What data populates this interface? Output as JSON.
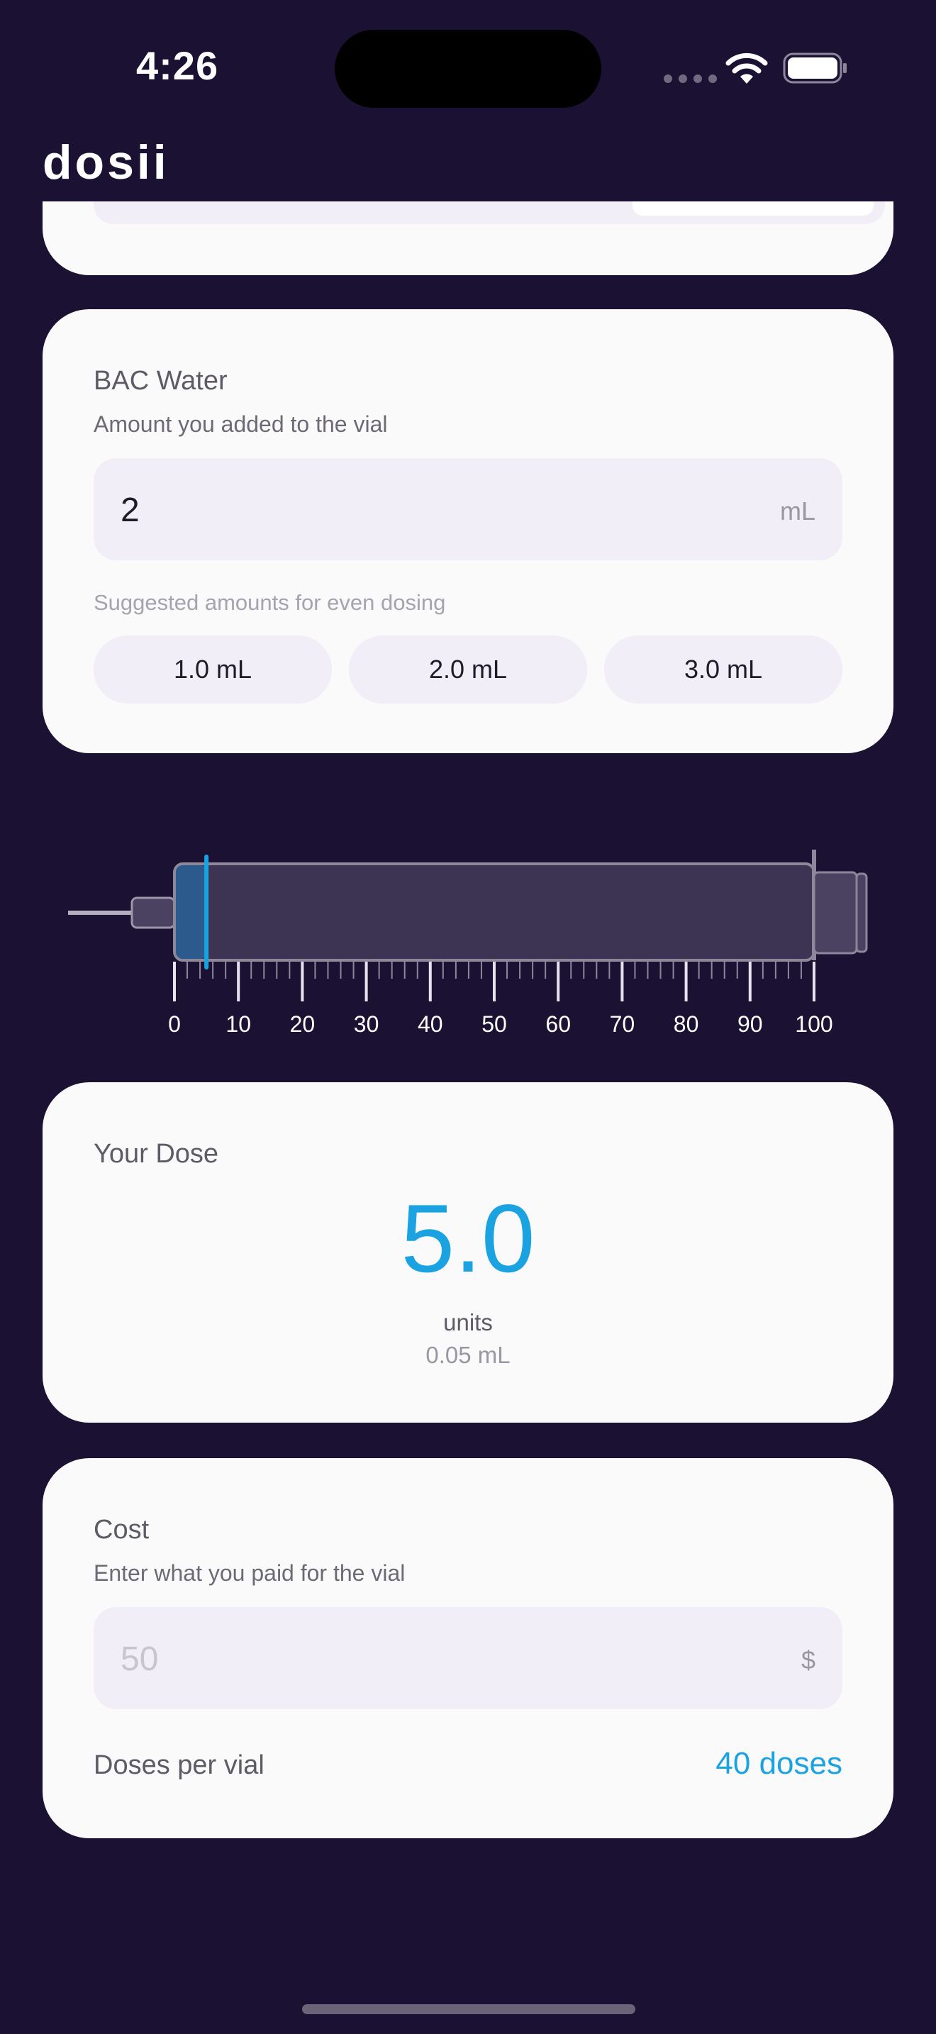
{
  "status_bar": {
    "time": "4:26"
  },
  "header": {
    "brand": "dosii"
  },
  "bac_water": {
    "title": "BAC Water",
    "subtitle": "Amount you added to the vial",
    "value": "2",
    "unit": "mL",
    "hint": "Suggested amounts for even dosing",
    "suggestions": [
      "1.0 mL",
      "2.0 mL",
      "3.0 mL"
    ]
  },
  "syringe": {
    "scale_labels": [
      "0",
      "10",
      "20",
      "30",
      "40",
      "50",
      "60",
      "70",
      "80",
      "90",
      "100"
    ],
    "fill_units": 5,
    "max_units": 100,
    "fill_color": "#2c5a8c",
    "marker_color": "#1aa3e0"
  },
  "dose": {
    "title": "Your Dose",
    "value": "5.0",
    "units_label": "units",
    "volume": "0.05 mL"
  },
  "cost": {
    "title": "Cost",
    "subtitle": "Enter what you paid for the vial",
    "placeholder": "50",
    "currency": "$",
    "doses_label": "Doses per vial",
    "doses_value": "40 doses"
  },
  "colors": {
    "background": "#1b1233",
    "card": "#fafafa",
    "accent": "#1aa3e0",
    "field": "#f1eef8"
  },
  "icons": [
    "cellular-signal-icon",
    "wifi-icon",
    "battery-icon"
  ]
}
